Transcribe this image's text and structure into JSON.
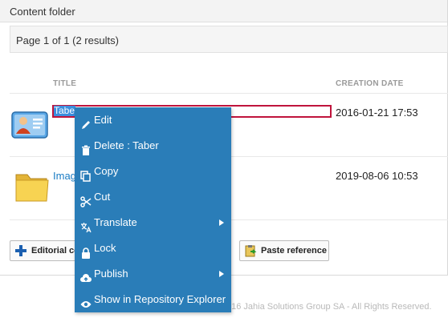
{
  "panel": {
    "title": "Content folder"
  },
  "pager": {
    "text": "Page 1 of 1 (2 results)"
  },
  "columns": {
    "title": "TITLE",
    "creation_date": "CREATION DATE"
  },
  "rows": [
    {
      "title": "Taber",
      "date": "2016-01-21 17:53",
      "icon": "user-card-icon",
      "selected": true
    },
    {
      "title": "Images",
      "date": "2019-08-06 10:53",
      "icon": "folder-icon",
      "selected": false
    }
  ],
  "toolbar": {
    "editorial_label": "Editorial content",
    "paste_reference_label": "Paste reference"
  },
  "footer": {
    "copyright": "016 Jahia Solutions Group SA - All Rights Reserved."
  },
  "context_menu": {
    "items": [
      {
        "label": "Edit",
        "icon": "pencil-icon",
        "submenu": false
      },
      {
        "label": "Delete : Taber",
        "icon": "trash-icon",
        "submenu": false
      },
      {
        "label": "Copy",
        "icon": "copy-icon",
        "submenu": false
      },
      {
        "label": "Cut",
        "icon": "scissors-icon",
        "submenu": false
      },
      {
        "label": "Translate",
        "icon": "translate-icon",
        "submenu": true
      },
      {
        "label": "Lock",
        "icon": "lock-icon",
        "submenu": false
      },
      {
        "label": "Publish",
        "icon": "cloud-upload-icon",
        "submenu": true
      },
      {
        "label": "Show in Repository Explorer",
        "icon": "eye-icon",
        "submenu": false
      }
    ]
  },
  "colors": {
    "menu_bg": "#2a7db8",
    "link": "#1a7cc4",
    "selection_border": "#c0143c"
  }
}
